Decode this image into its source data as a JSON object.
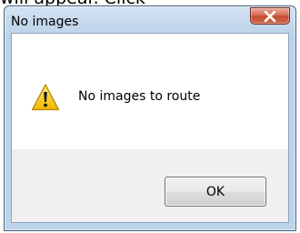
{
  "background_text": "will appear. Click",
  "dialog": {
    "title": "No images",
    "close_icon": "close-x-icon",
    "message": "No images to route",
    "message_icon": "warning-icon",
    "ok_label": "OK"
  },
  "colors": {
    "frame": "#bcd3ea",
    "close_button": "#c44a2e",
    "warning_yellow": "#f2c200",
    "button_strip": "#f0f0f0"
  }
}
